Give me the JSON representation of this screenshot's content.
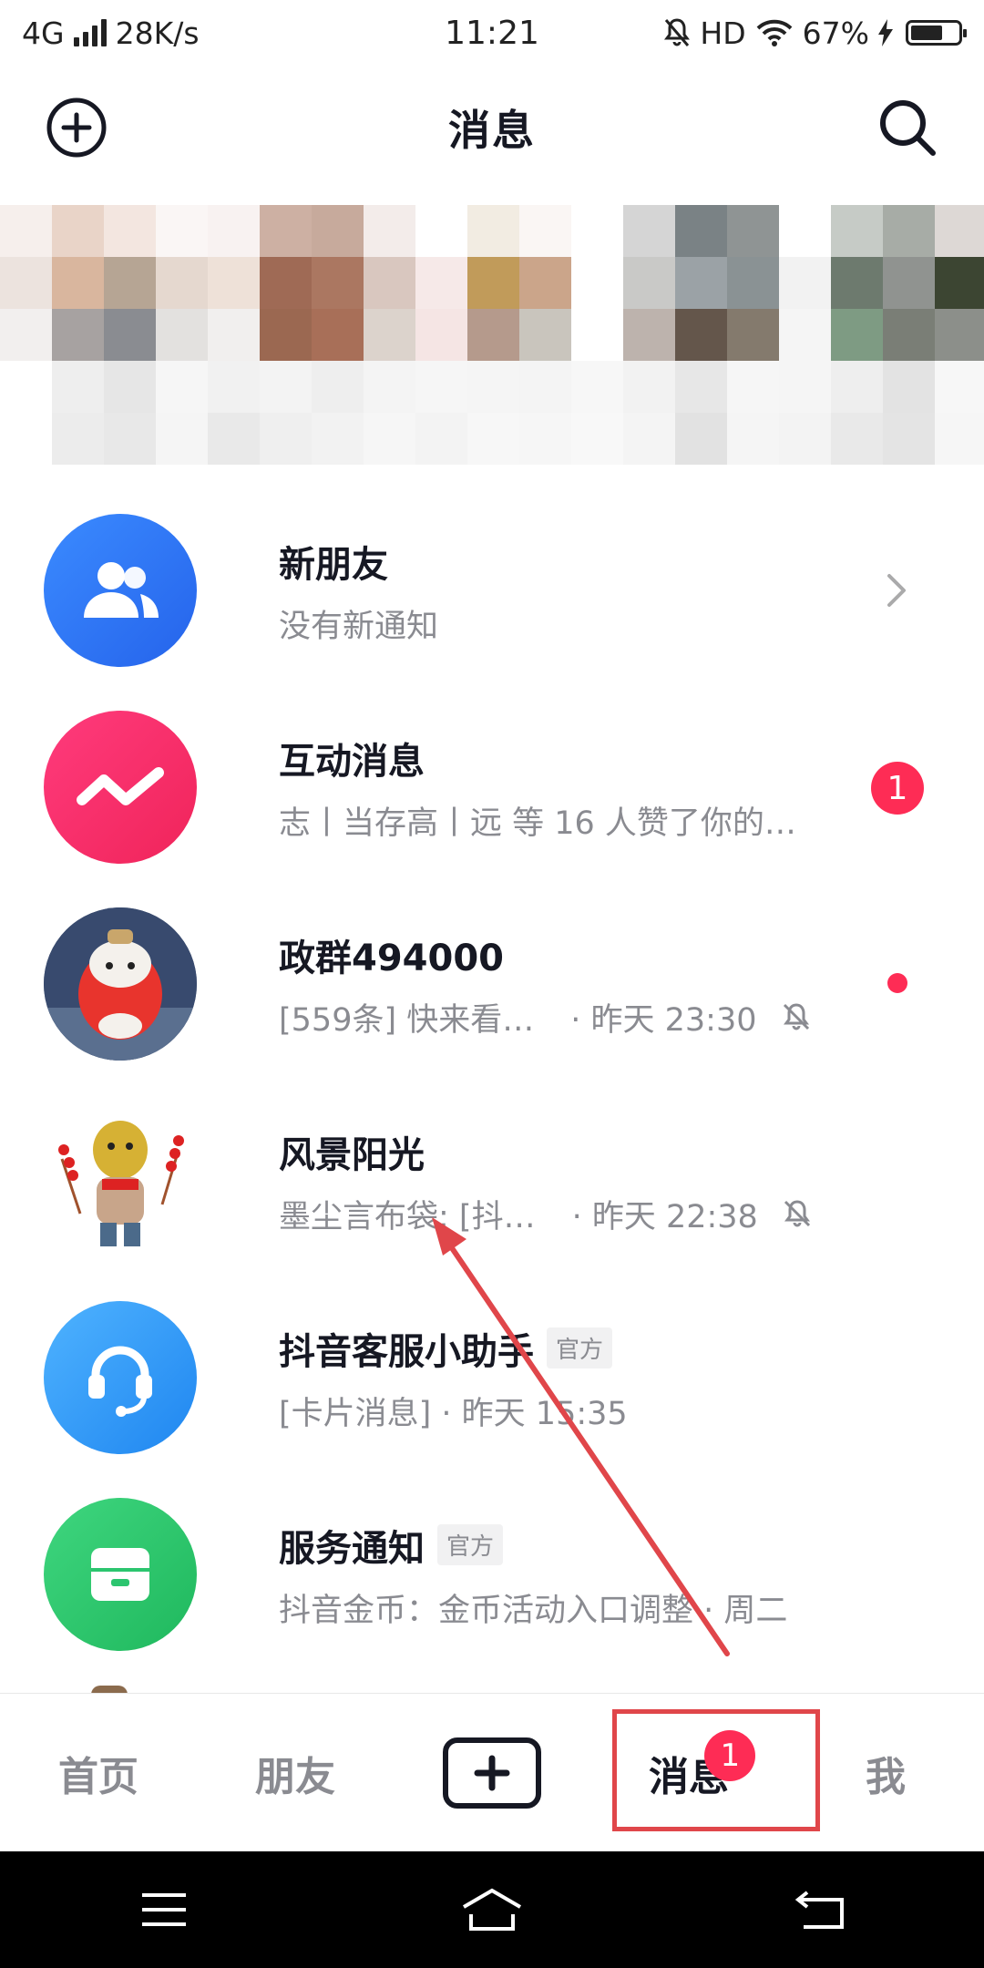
{
  "status_bar": {
    "network": "4G",
    "speed": "28K/s",
    "time": "11:21",
    "hd": "HD",
    "battery_percent": "67%",
    "battery_level": 0.67
  },
  "header": {
    "title": "消息",
    "add_icon": "plus-circle-icon",
    "search_icon": "search-icon"
  },
  "messages": [
    {
      "title": "新朋友",
      "subtitle": "没有新通知",
      "avatar_color": "#3b82f6",
      "icon": "friends-icon"
    },
    {
      "title": "互动消息",
      "subtitle": "志丨当存高丨远 等 16 人赞了你的…",
      "badge": "1",
      "avatar_color": "#fe2c55",
      "icon": "zigzag-icon"
    },
    {
      "title": "政群494000",
      "preview": "[559条] 快来看…",
      "time": "· 昨天 23:30",
      "muted": true,
      "unread_dot": true
    },
    {
      "title": "风景阳光",
      "preview": "墨尘言布袋: [抖…",
      "time": "· 昨天 22:38",
      "muted": true
    },
    {
      "title": "抖音客服小助手",
      "tag": "官方",
      "preview": "[卡片消息] · 昨天 15:35",
      "avatar_color": "#2f9bf5",
      "icon": "headset-icon"
    },
    {
      "title": "服务通知",
      "tag": "官方",
      "preview": "抖音金币：金币活动入口调整 · 周二",
      "avatar_color": "#2cc56f",
      "icon": "inbox-icon"
    }
  ],
  "bottom_nav": {
    "home": "首页",
    "friends": "朋友",
    "messages": "消息",
    "messages_badge": "1",
    "me": "我"
  },
  "colors": {
    "accent": "#fe2c55",
    "annotation": "#e0464a"
  }
}
